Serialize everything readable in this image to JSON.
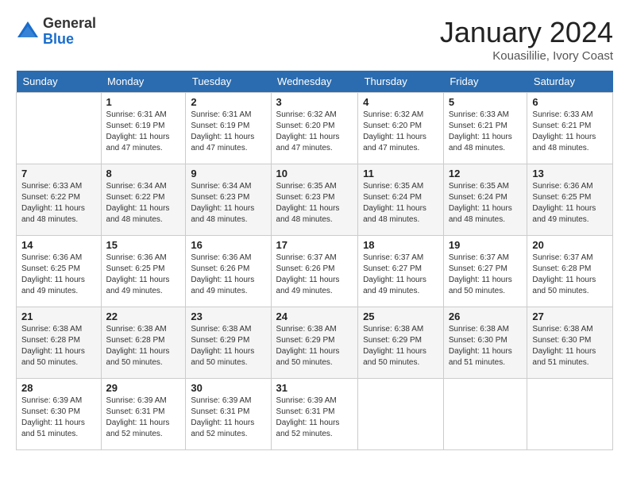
{
  "header": {
    "logo_general": "General",
    "logo_blue": "Blue",
    "month": "January 2024",
    "location": "Kouasililie, Ivory Coast"
  },
  "days_of_week": [
    "Sunday",
    "Monday",
    "Tuesday",
    "Wednesday",
    "Thursday",
    "Friday",
    "Saturday"
  ],
  "weeks": [
    [
      {
        "day": "",
        "sunrise": "",
        "sunset": "",
        "daylight": ""
      },
      {
        "day": "1",
        "sunrise": "Sunrise: 6:31 AM",
        "sunset": "Sunset: 6:19 PM",
        "daylight": "Daylight: 11 hours and 47 minutes."
      },
      {
        "day": "2",
        "sunrise": "Sunrise: 6:31 AM",
        "sunset": "Sunset: 6:19 PM",
        "daylight": "Daylight: 11 hours and 47 minutes."
      },
      {
        "day": "3",
        "sunrise": "Sunrise: 6:32 AM",
        "sunset": "Sunset: 6:20 PM",
        "daylight": "Daylight: 11 hours and 47 minutes."
      },
      {
        "day": "4",
        "sunrise": "Sunrise: 6:32 AM",
        "sunset": "Sunset: 6:20 PM",
        "daylight": "Daylight: 11 hours and 47 minutes."
      },
      {
        "day": "5",
        "sunrise": "Sunrise: 6:33 AM",
        "sunset": "Sunset: 6:21 PM",
        "daylight": "Daylight: 11 hours and 48 minutes."
      },
      {
        "day": "6",
        "sunrise": "Sunrise: 6:33 AM",
        "sunset": "Sunset: 6:21 PM",
        "daylight": "Daylight: 11 hours and 48 minutes."
      }
    ],
    [
      {
        "day": "7",
        "sunrise": "Sunrise: 6:33 AM",
        "sunset": "Sunset: 6:22 PM",
        "daylight": "Daylight: 11 hours and 48 minutes."
      },
      {
        "day": "8",
        "sunrise": "Sunrise: 6:34 AM",
        "sunset": "Sunset: 6:22 PM",
        "daylight": "Daylight: 11 hours and 48 minutes."
      },
      {
        "day": "9",
        "sunrise": "Sunrise: 6:34 AM",
        "sunset": "Sunset: 6:23 PM",
        "daylight": "Daylight: 11 hours and 48 minutes."
      },
      {
        "day": "10",
        "sunrise": "Sunrise: 6:35 AM",
        "sunset": "Sunset: 6:23 PM",
        "daylight": "Daylight: 11 hours and 48 minutes."
      },
      {
        "day": "11",
        "sunrise": "Sunrise: 6:35 AM",
        "sunset": "Sunset: 6:24 PM",
        "daylight": "Daylight: 11 hours and 48 minutes."
      },
      {
        "day": "12",
        "sunrise": "Sunrise: 6:35 AM",
        "sunset": "Sunset: 6:24 PM",
        "daylight": "Daylight: 11 hours and 48 minutes."
      },
      {
        "day": "13",
        "sunrise": "Sunrise: 6:36 AM",
        "sunset": "Sunset: 6:25 PM",
        "daylight": "Daylight: 11 hours and 49 minutes."
      }
    ],
    [
      {
        "day": "14",
        "sunrise": "Sunrise: 6:36 AM",
        "sunset": "Sunset: 6:25 PM",
        "daylight": "Daylight: 11 hours and 49 minutes."
      },
      {
        "day": "15",
        "sunrise": "Sunrise: 6:36 AM",
        "sunset": "Sunset: 6:25 PM",
        "daylight": "Daylight: 11 hours and 49 minutes."
      },
      {
        "day": "16",
        "sunrise": "Sunrise: 6:36 AM",
        "sunset": "Sunset: 6:26 PM",
        "daylight": "Daylight: 11 hours and 49 minutes."
      },
      {
        "day": "17",
        "sunrise": "Sunrise: 6:37 AM",
        "sunset": "Sunset: 6:26 PM",
        "daylight": "Daylight: 11 hours and 49 minutes."
      },
      {
        "day": "18",
        "sunrise": "Sunrise: 6:37 AM",
        "sunset": "Sunset: 6:27 PM",
        "daylight": "Daylight: 11 hours and 49 minutes."
      },
      {
        "day": "19",
        "sunrise": "Sunrise: 6:37 AM",
        "sunset": "Sunset: 6:27 PM",
        "daylight": "Daylight: 11 hours and 50 minutes."
      },
      {
        "day": "20",
        "sunrise": "Sunrise: 6:37 AM",
        "sunset": "Sunset: 6:28 PM",
        "daylight": "Daylight: 11 hours and 50 minutes."
      }
    ],
    [
      {
        "day": "21",
        "sunrise": "Sunrise: 6:38 AM",
        "sunset": "Sunset: 6:28 PM",
        "daylight": "Daylight: 11 hours and 50 minutes."
      },
      {
        "day": "22",
        "sunrise": "Sunrise: 6:38 AM",
        "sunset": "Sunset: 6:28 PM",
        "daylight": "Daylight: 11 hours and 50 minutes."
      },
      {
        "day": "23",
        "sunrise": "Sunrise: 6:38 AM",
        "sunset": "Sunset: 6:29 PM",
        "daylight": "Daylight: 11 hours and 50 minutes."
      },
      {
        "day": "24",
        "sunrise": "Sunrise: 6:38 AM",
        "sunset": "Sunset: 6:29 PM",
        "daylight": "Daylight: 11 hours and 50 minutes."
      },
      {
        "day": "25",
        "sunrise": "Sunrise: 6:38 AM",
        "sunset": "Sunset: 6:29 PM",
        "daylight": "Daylight: 11 hours and 50 minutes."
      },
      {
        "day": "26",
        "sunrise": "Sunrise: 6:38 AM",
        "sunset": "Sunset: 6:30 PM",
        "daylight": "Daylight: 11 hours and 51 minutes."
      },
      {
        "day": "27",
        "sunrise": "Sunrise: 6:38 AM",
        "sunset": "Sunset: 6:30 PM",
        "daylight": "Daylight: 11 hours and 51 minutes."
      }
    ],
    [
      {
        "day": "28",
        "sunrise": "Sunrise: 6:39 AM",
        "sunset": "Sunset: 6:30 PM",
        "daylight": "Daylight: 11 hours and 51 minutes."
      },
      {
        "day": "29",
        "sunrise": "Sunrise: 6:39 AM",
        "sunset": "Sunset: 6:31 PM",
        "daylight": "Daylight: 11 hours and 52 minutes."
      },
      {
        "day": "30",
        "sunrise": "Sunrise: 6:39 AM",
        "sunset": "Sunset: 6:31 PM",
        "daylight": "Daylight: 11 hours and 52 minutes."
      },
      {
        "day": "31",
        "sunrise": "Sunrise: 6:39 AM",
        "sunset": "Sunset: 6:31 PM",
        "daylight": "Daylight: 11 hours and 52 minutes."
      },
      {
        "day": "",
        "sunrise": "",
        "sunset": "",
        "daylight": ""
      },
      {
        "day": "",
        "sunrise": "",
        "sunset": "",
        "daylight": ""
      },
      {
        "day": "",
        "sunrise": "",
        "sunset": "",
        "daylight": ""
      }
    ]
  ]
}
